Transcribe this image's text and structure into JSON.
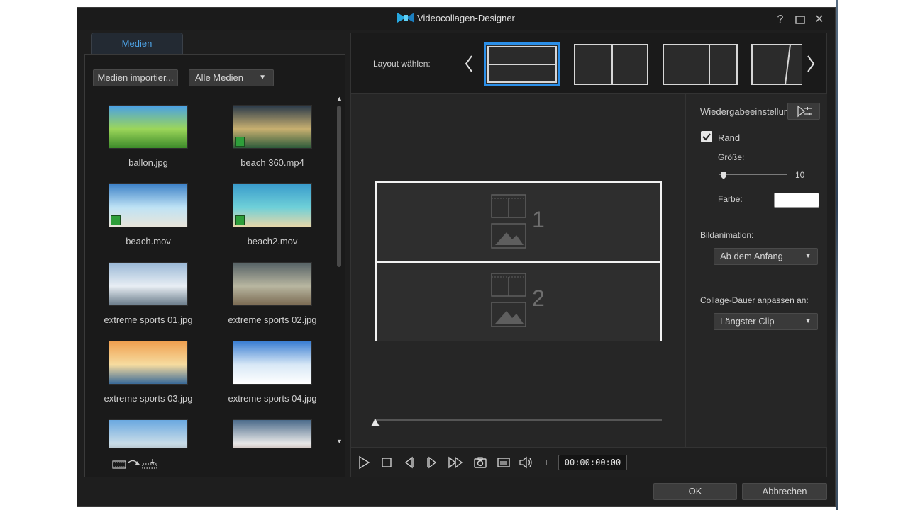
{
  "window": {
    "title": "Videocollagen-Designer",
    "help_label": "?",
    "close_label": "✕"
  },
  "media": {
    "tab_label": "Medien",
    "import_label": "Medien importier...",
    "filter_label": "Alle Medien",
    "items": [
      {
        "label": "ballon.jpg",
        "video": false,
        "colors": [
          "#4aa0e6",
          "#9cd65a",
          "#3c8a2a"
        ]
      },
      {
        "label": "beach 360.mp4",
        "video": true,
        "colors": [
          "#2a3a4a",
          "#c8b070",
          "#2d5a3a"
        ]
      },
      {
        "label": "beach.mov",
        "video": true,
        "colors": [
          "#3f83c8",
          "#bfe3f5",
          "#e8e4da"
        ]
      },
      {
        "label": "beach2.mov",
        "video": true,
        "colors": [
          "#3a9ccc",
          "#6fd0d8",
          "#e6d6a8"
        ]
      },
      {
        "label": "extreme sports 01.jpg",
        "video": false,
        "colors": [
          "#9ab8d6",
          "#e8eef4",
          "#6a7c8a"
        ]
      },
      {
        "label": "extreme sports 02.jpg",
        "video": false,
        "colors": [
          "#566266",
          "#b8b6a0",
          "#7a6a52"
        ]
      },
      {
        "label": "extreme sports 03.jpg",
        "video": false,
        "colors": [
          "#f0a050",
          "#f6dca0",
          "#3a6a98"
        ]
      },
      {
        "label": "extreme sports 04.jpg",
        "video": false,
        "colors": [
          "#3a7ed2",
          "#d8e8f6",
          "#ffffff"
        ]
      },
      {
        "label": "",
        "video": false,
        "colors": [
          "#6aa8e0",
          "#c8dce8",
          "#8a8a8a"
        ]
      },
      {
        "label": "",
        "video": false,
        "colors": [
          "#4a6a8a",
          "#e8e8e8",
          "#8a5a4a"
        ]
      }
    ]
  },
  "layout": {
    "label": "Layout wählen:"
  },
  "collage": {
    "slot1": "1",
    "slot2": "2"
  },
  "settings": {
    "playback_label": "Wiedergabeeinstellun",
    "border_label": "Rand",
    "border_checked": true,
    "size_label": "Größe:",
    "size_value": "10",
    "color_label": "Farbe:",
    "border_color": "#ffffff",
    "animation_label": "Bildanimation:",
    "animation_value": "Ab dem Anfang",
    "duration_label": "Collage-Dauer anpassen an:",
    "duration_value": "Längster Clip"
  },
  "player": {
    "timecode": "00:00:00:00"
  },
  "footer": {
    "ok_label": "OK",
    "cancel_label": "Abbrechen"
  },
  "colors": {
    "accent": "#4ea3e6",
    "selected_layout_border": "#2b8fe8"
  }
}
